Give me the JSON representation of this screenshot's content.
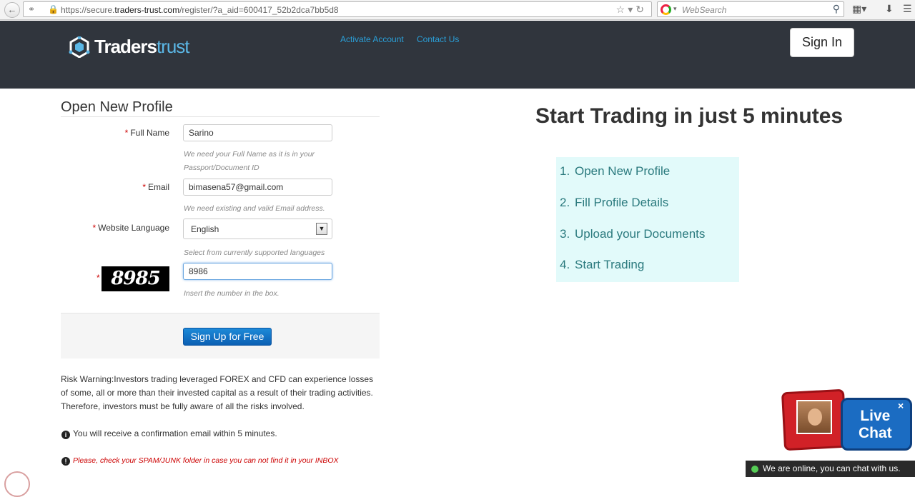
{
  "browser": {
    "url_prefix": "https://secure.",
    "url_domain": "traders-trust.com",
    "url_path": "/register/?a_aid=600417_52b2dca7bb5d8",
    "search_placeholder": "WebSearch"
  },
  "header": {
    "logo_bold": "Traders",
    "logo_light": "trust",
    "nav": [
      "Activate Account",
      "Contact Us"
    ],
    "sign_in": "Sign In"
  },
  "form": {
    "title": "Open New Profile",
    "full_name": {
      "label": "Full Name",
      "value": "Sarino",
      "hint": "We need your Full Name as it is in your Passport/Document ID"
    },
    "email": {
      "label": "Email",
      "value": "bimasena57@gmail.com",
      "hint": "We need existing and valid Email address."
    },
    "language": {
      "label": "Website Language",
      "value": "English",
      "hint": "Select from currently supported languages"
    },
    "captcha": {
      "image_text": "8985",
      "value": "8986",
      "hint": "Insert the number in the box."
    },
    "required_mark": "*",
    "submit": "Sign Up for Free",
    "risk_warning": "Risk Warning:Investors trading leveraged FOREX and CFD can experience losses of some, all or more than their invested capital as a result of their trading activities. Therefore, investors must be fully aware of all the risks involved.",
    "notice_info": "You will receive a confirmation email within 5 minutes.",
    "notice_warn": "Please, check your SPAM/JUNK folder in case you can not find it in your INBOX"
  },
  "hero": {
    "title": "Start Trading in just 5 minutes",
    "steps": [
      {
        "num": "1.",
        "text": "Open New Profile"
      },
      {
        "num": "2.",
        "text": "Fill Profile Details"
      },
      {
        "num": "3.",
        "text": "Upload your Documents"
      },
      {
        "num": "4.",
        "text": "Start Trading"
      }
    ]
  },
  "chat": {
    "line1": "Live",
    "line2": "Chat",
    "close": "×",
    "status": "We are online, you can chat with us."
  }
}
